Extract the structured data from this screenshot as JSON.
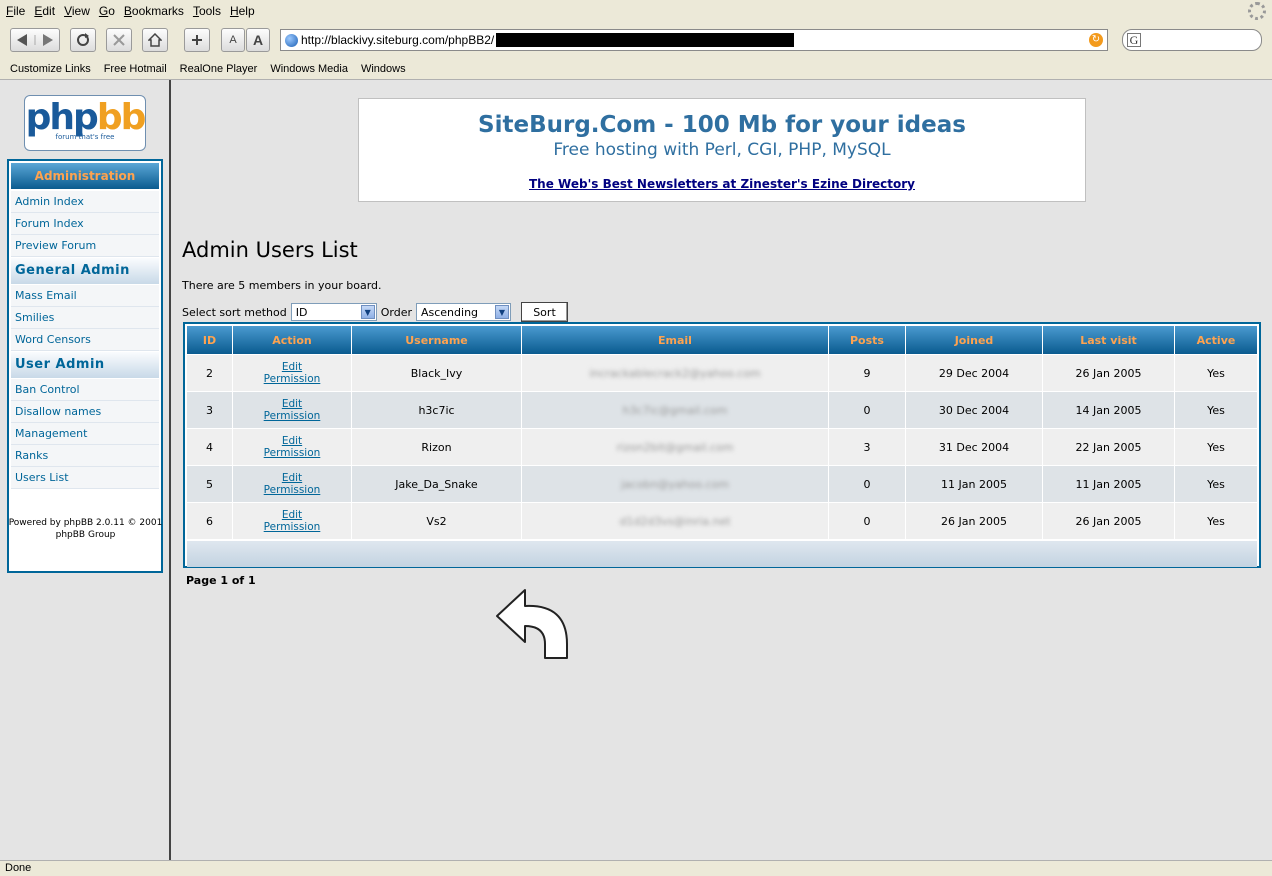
{
  "browser": {
    "menu": [
      "File",
      "Edit",
      "View",
      "Go",
      "Bookmarks",
      "Tools",
      "Help"
    ],
    "url": "http://blackivy.siteburg.com/phpBB2/",
    "links": [
      "Customize Links",
      "Free Hotmail",
      "RealOne Player",
      "Windows Media",
      "Windows"
    ],
    "status": "Done",
    "search_letter": "G",
    "font_small": "A",
    "font_large": "A"
  },
  "logo": {
    "part1": "php",
    "part2": "bb",
    "tagline": "forum that's free"
  },
  "nav": {
    "header": "Administration",
    "items_top": [
      "Admin Index",
      "Forum Index",
      "Preview Forum"
    ],
    "cat_general": "General Admin",
    "items_general": [
      "Mass Email",
      "Smilies",
      "Word Censors"
    ],
    "cat_user": "User Admin",
    "items_user": [
      "Ban Control",
      "Disallow names",
      "Management",
      "Ranks",
      "Users List"
    ]
  },
  "powered": {
    "line1": "Powered by phpBB 2.0.11 © 2001",
    "line2": "phpBB Group"
  },
  "banner": {
    "title": "SiteBurg.Com - 100 Mb for your ideas",
    "subtitle": "Free hosting with Perl, CGI, PHP, MySQL",
    "link": "The Web's Best Newsletters at Zinester's Ezine Directory"
  },
  "main": {
    "title": "Admin Users List",
    "member_count": "There are 5 members in your board.",
    "sort_label": "Select sort method",
    "sort_value": "ID",
    "order_label": "Order",
    "order_value": "Ascending",
    "sort_button": "Sort",
    "page_info": "Page 1 of 1"
  },
  "table": {
    "headers": [
      "ID",
      "Action",
      "Username",
      "Email",
      "Posts",
      "Joined",
      "Last visit",
      "Active"
    ],
    "edit_label": "Edit",
    "permission_label": "Permission",
    "rows": [
      {
        "id": "2",
        "username": "Black_Ivy",
        "email": "incrackablecrack2@yahoo.com",
        "posts": "9",
        "joined": "29 Dec 2004",
        "last_visit": "26 Jan 2005",
        "active": "Yes"
      },
      {
        "id": "3",
        "username": "h3c7ic",
        "email": "h3c7ic@gmail.com",
        "posts": "0",
        "joined": "30 Dec 2004",
        "last_visit": "14 Jan 2005",
        "active": "Yes"
      },
      {
        "id": "4",
        "username": "Rizon",
        "email": "rizon2bit@gmail.com",
        "posts": "3",
        "joined": "31 Dec 2004",
        "last_visit": "22 Jan 2005",
        "active": "Yes"
      },
      {
        "id": "5",
        "username": "Jake_Da_Snake",
        "email": "jacobn@yahoo.com",
        "posts": "0",
        "joined": "11 Jan 2005",
        "last_visit": "11 Jan 2005",
        "active": "Yes"
      },
      {
        "id": "6",
        "username": "Vs2",
        "email": "d1d2d3vs@inria.net",
        "posts": "0",
        "joined": "26 Jan 2005",
        "last_visit": "26 Jan 2005",
        "active": "Yes"
      }
    ]
  }
}
